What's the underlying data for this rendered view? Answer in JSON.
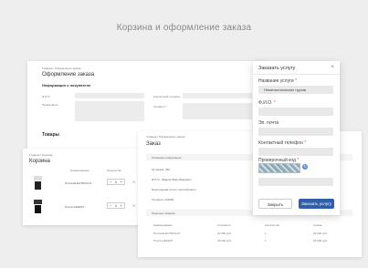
{
  "page": {
    "title": "Корзина и оформление заказа"
  },
  "checkout_back": {
    "breadcrumb": "Главная / Оформление заказа",
    "title": "Оформление заказа",
    "buyer_section": "Информация о покупателе",
    "fields": [
      "Ф.И.О.",
      "Контактный телефон",
      "Примечания",
      "Телефон *"
    ],
    "goods_title": "Товары"
  },
  "cart": {
    "breadcrumb": "Главная / Корзина",
    "title": "Корзина",
    "columns": [
      "Наименование",
      "Количество"
    ],
    "items": [
      {
        "name": "Плита ELECTROLUX",
        "qty": "1"
      },
      {
        "name": "Плита GEFEST",
        "qty": "1"
      }
    ]
  },
  "order": {
    "breadcrumb": "Главная / Оформление заказа",
    "title": "Заказ",
    "section_info": "Основная информация",
    "fields": [
      "№ заказа: 456",
      "Ф.И.О.: Иванов Иван Иванович",
      "Электронная почта: ivanov@mail.ru",
      "Телефон: 123456"
    ],
    "section_goods": "Перечень товаров",
    "columns": [
      "Наименование",
      "Стоимость",
      "Количество",
      "Сумма"
    ],
    "rows": [
      [
        "Плита ELECTROLUX",
        "20 000 руб.",
        "1",
        "20 000 руб."
      ],
      [
        "Плита GEFEST",
        "18 000 руб.",
        "1",
        "18 000 руб."
      ]
    ]
  },
  "modal": {
    "title": "Заказать услугу",
    "service_label": "Название услуги",
    "service_value": "Неметаллических грузов",
    "fio_label": "Ф.И.О.",
    "email_label": "Эл. почта",
    "phone_label": "Контактный телефон",
    "captcha_label": "Проверочный код",
    "required_mark": "*",
    "close_button": "Закрыть",
    "submit_button": "Заказать услугу",
    "close_icon": "×",
    "refresh_icon": "↻"
  },
  "colors": {
    "accent": "#2f5fa8",
    "required": "#d9534f",
    "background": "#eeeeee"
  }
}
